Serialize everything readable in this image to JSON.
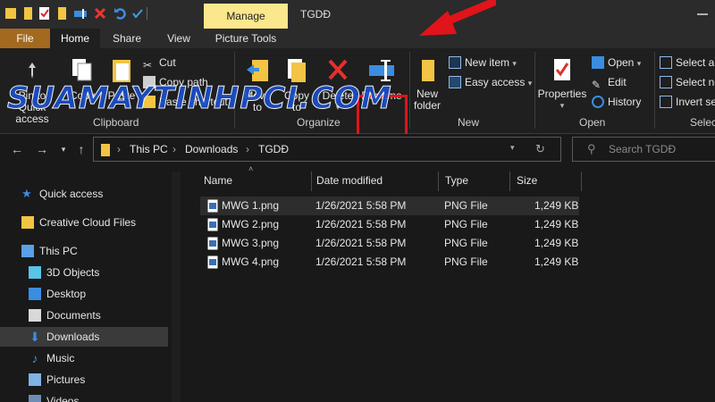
{
  "window": {
    "title": "TGDĐ",
    "context_tab": "Manage"
  },
  "ribbon_tabs": [
    "File",
    "Home",
    "Share",
    "View",
    "Picture Tools"
  ],
  "ribbon": {
    "clipboard": {
      "label": "Clipboard",
      "pin": "Pin to Quick access",
      "copy": "Copy",
      "paste": "Paste",
      "cut": "Cut",
      "copy_path": "Copy path",
      "paste_shortcut": "Paste shortcut"
    },
    "organize": {
      "label": "Organize",
      "move_to": "Move to",
      "copy_to": "Copy to",
      "delete": "Delete",
      "rename": "Rename"
    },
    "new": {
      "label": "New",
      "new_folder_1": "New",
      "new_folder_2": "folder",
      "new_item": "New item",
      "easy_access": "Easy access"
    },
    "open": {
      "label": "Open",
      "properties": "Properties",
      "open": "Open",
      "edit": "Edit",
      "history": "History"
    },
    "select": {
      "label": "Select",
      "select_all": "Select all",
      "select_none": "Select none",
      "invert": "Invert selection"
    }
  },
  "watermark": "SUAMAYTINHPCI.COM",
  "breadcrumb": [
    "This PC",
    "Downloads",
    "TGDĐ"
  ],
  "search": {
    "placeholder": "Search TGDĐ"
  },
  "nav": [
    {
      "label": "Quick access",
      "icon": "star-icon"
    },
    {
      "label": "Creative Cloud Files",
      "icon": "creative-cloud-icon"
    },
    {
      "label": "This PC",
      "icon": "computer-icon"
    },
    {
      "label": "3D Objects",
      "icon": "cube-icon"
    },
    {
      "label": "Desktop",
      "icon": "desktop-icon"
    },
    {
      "label": "Documents",
      "icon": "documents-icon"
    },
    {
      "label": "Downloads",
      "icon": "download-icon"
    },
    {
      "label": "Music",
      "icon": "music-icon"
    },
    {
      "label": "Pictures",
      "icon": "pictures-icon"
    },
    {
      "label": "Videos",
      "icon": "videos-icon"
    }
  ],
  "columns": [
    "Name",
    "Date modified",
    "Type",
    "Size"
  ],
  "files": [
    {
      "name": "MWG 1.png",
      "date": "1/26/2021 5:58 PM",
      "type": "PNG File",
      "size": "1,249 KB"
    },
    {
      "name": "MWG 2.png",
      "date": "1/26/2021 5:58 PM",
      "type": "PNG File",
      "size": "1,249 KB"
    },
    {
      "name": "MWG 3.png",
      "date": "1/26/2021 5:58 PM",
      "type": "PNG File",
      "size": "1,249 KB"
    },
    {
      "name": "MWG 4.png",
      "date": "1/26/2021 5:58 PM",
      "type": "PNG File",
      "size": "1,249 KB"
    }
  ],
  "colors": {
    "file_tab": "#a3691f",
    "manage_tab": "#fbe78c",
    "highlight": "#e0141a",
    "watermark": "#1a4ec9"
  }
}
